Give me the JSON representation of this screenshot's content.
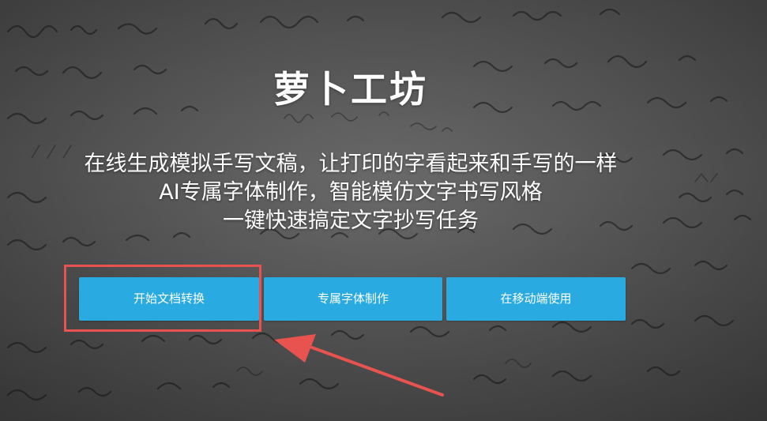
{
  "site": {
    "title": "萝卜工坊"
  },
  "taglines": [
    "在线生成模拟手写文稿，让打印的字看起来和手写的一样",
    "AI专属字体制作，智能模仿文字书写风格",
    "一键快速搞定文字抄写任务"
  ],
  "buttons": {
    "convert": "开始文档转换",
    "font": "专属字体制作",
    "mobile": "在移动端使用"
  },
  "colors": {
    "button": "#29abe2",
    "highlight": "#e8534f",
    "text": "#ffffff"
  },
  "annotation": {
    "highlight_target": "开始文档转换",
    "marker_icon": "red-arrow-icon"
  }
}
